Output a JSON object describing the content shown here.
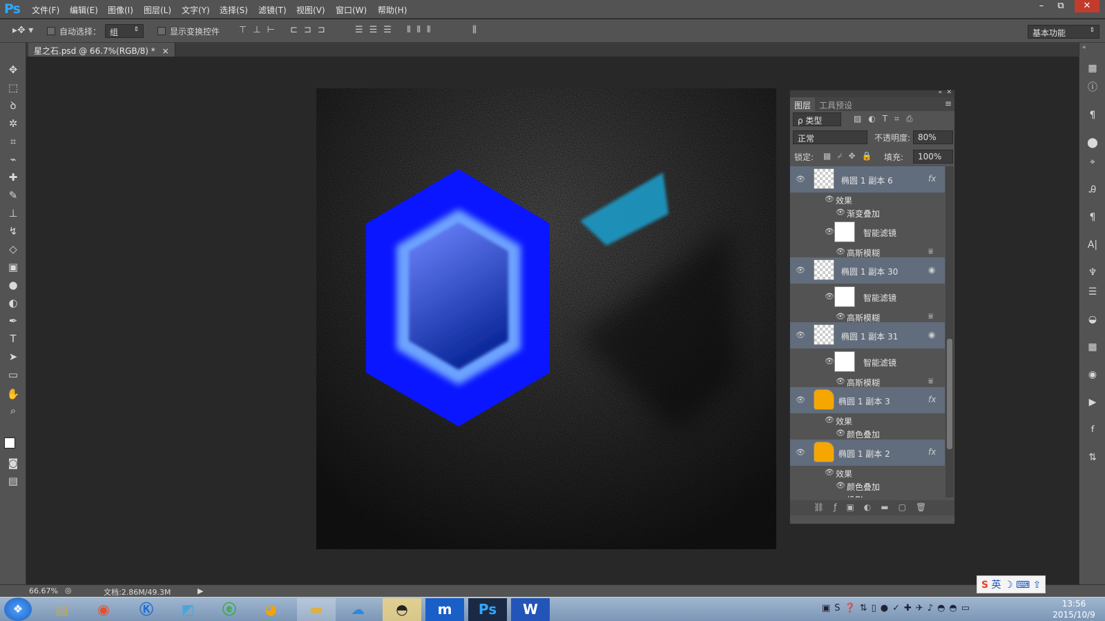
{
  "app": {
    "logo": "Ps"
  },
  "menu": [
    "文件(F)",
    "编辑(E)",
    "图像(I)",
    "图层(L)",
    "文字(Y)",
    "选择(S)",
    "滤镜(T)",
    "视图(V)",
    "窗口(W)",
    "帮助(H)"
  ],
  "window_controls": {
    "minimize": "–",
    "restore": "⧉",
    "close": "✕"
  },
  "options": {
    "auto_select_label": "自动选择：",
    "auto_select_value": "组",
    "show_transform_label": "显示变换控件",
    "workspace": "基本功能"
  },
  "document_tab": {
    "title": "星之石.psd @ 66.7%(RGB/8) *",
    "close": "×"
  },
  "status": {
    "zoom": "66.67%",
    "doc_info": "文档:2.86M/49.3M"
  },
  "layers_panel": {
    "tabs": [
      "图层",
      "工具预设"
    ],
    "filter_label": "ρ 类型",
    "blend_mode": "正常",
    "opacity_label": "不透明度:",
    "opacity_value": "80%",
    "lock_label": "锁定:",
    "fill_label": "填充:",
    "fill_value": "100%",
    "fx": "fx",
    "layers": [
      {
        "name": "椭圆 1 副本 6",
        "effects_label": "效果",
        "effects": [
          "渐变叠加"
        ],
        "smart_filter_label": "智能滤镜",
        "filters": [
          "高斯模糊"
        ]
      },
      {
        "name": "椭圆 1 副本 30",
        "smart_filter_label": "智能滤镜",
        "filters": [
          "高斯模糊"
        ]
      },
      {
        "name": "椭圆 1 副本 31",
        "smart_filter_label": "智能滤镜",
        "filters": [
          "高斯模糊"
        ]
      },
      {
        "name": "椭圆 1 副本 3",
        "effects_label": "效果",
        "effects": [
          "颜色叠加"
        ]
      },
      {
        "name": "椭圆 1 副本 2",
        "effects_label": "效果",
        "effects": [
          "颜色叠加",
          "投影"
        ]
      }
    ]
  },
  "taskbar": {
    "ime": "英",
    "time": "13:56",
    "date": "2015/10/9",
    "apps": [
      "notes-app-icon",
      "balloon-app-icon",
      "k-player-icon",
      "pen-app-icon",
      "browser-icon",
      "media-icon",
      "folder-icon",
      "cloud-icon",
      "qq-icon",
      "m-app-icon",
      "photoshop-icon",
      "word-icon"
    ]
  },
  "colors": {
    "hex_outer": "#0a16ff",
    "hex_inner": "#1e3bd6",
    "teal": "#1a9ac6"
  }
}
